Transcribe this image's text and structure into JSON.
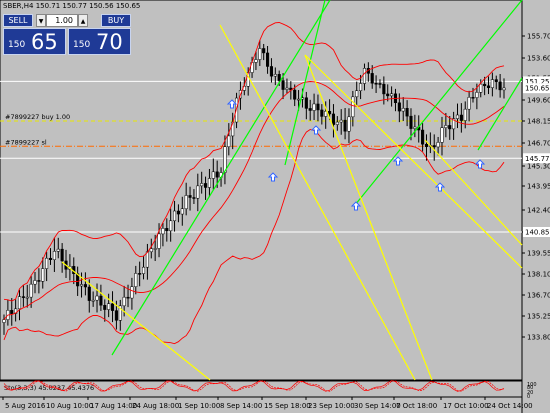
{
  "header": {
    "symbol_line": "SBER,H4  150.71 150.77 150.56 150.65"
  },
  "trade_panel": {
    "sell_label": "SELL",
    "buy_label": "BUY",
    "lots_value": "1.00",
    "sell_small": "150",
    "sell_big": "65",
    "buy_small": "150",
    "buy_big": "70"
  },
  "price_axis": {
    "ticks": [
      "155.70",
      "153.60",
      "151.55",
      "149.60",
      "148.15",
      "146.70",
      "145.30",
      "143.95",
      "142.40",
      "140.85",
      "139.55",
      "138.10",
      "136.70",
      "135.25",
      "133.80"
    ],
    "tick_values": [
      155.7,
      153.6,
      151.55,
      149.6,
      148.15,
      146.7,
      145.3,
      143.95,
      142.4,
      140.85,
      139.55,
      138.1,
      136.7,
      135.25,
      133.8
    ],
    "current_price": "150.65",
    "marker_hi": "151.25",
    "marker_mid": "145.77",
    "marker_lo": "140.85"
  },
  "horizontal_lines": [
    {
      "label": "#7899227 buy 1.00",
      "price": 148.15,
      "color": "#e8e800",
      "style": "dashed"
    },
    {
      "label": "#7899227 sl",
      "price": 146.5,
      "color": "#ff6a00",
      "style": "dashdot"
    }
  ],
  "time_axis": {
    "labels": [
      "5 Aug 2016",
      "10 Aug 10:00",
      "17 Aug 14:00",
      "24 Aug 18:00",
      "1 Sep 10:00",
      "8 Sep 14:00",
      "15 Sep 18:00",
      "23 Sep 10:00",
      "30 Sep 14:00",
      "7 Oct 18:00",
      "17 Oct 10:00",
      "24 Oct 14:00"
    ]
  },
  "indicator": {
    "label": "Sto(3,3,3) 45.0237 45.4376",
    "levels": [
      "100",
      "80",
      "20",
      "0"
    ]
  },
  "colors": {
    "background": "#c0c0c0",
    "bull": "#ffffff",
    "bear": "#000000",
    "bollinger": "#ff0000",
    "uptrend": "#00ff00",
    "downtrend": "#ffff00",
    "arrow": "#3366ff"
  }
}
